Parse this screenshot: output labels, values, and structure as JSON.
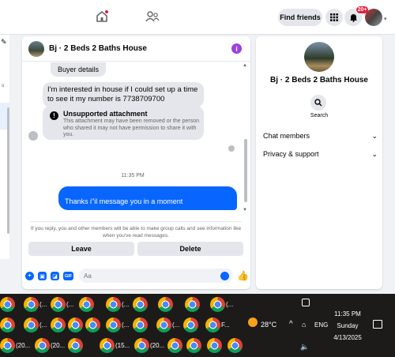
{
  "topbar": {
    "find_friends": "Find friends",
    "notification_count": "20+"
  },
  "chat": {
    "title": "Bj · 2 Beds 2 Baths House",
    "buyer_details": "Buyer details",
    "message_1": "I'm interested in house if I could set up a time to see it my number is 7738709700",
    "unsupported_title": "Unsupported attachment",
    "unsupported_text": "This attachment may have been removed or the person who shared it may not have permission to share it with you.",
    "timestamp": "11:35 PM",
    "my_message": "Thanks i\"il message you in a moment",
    "notice": "If you reply, you and other members will be able to make group calls and see information like when you've read messages.",
    "leave": "Leave",
    "delete": "Delete",
    "input_placeholder": "Aa",
    "gif_label": "GIF"
  },
  "details": {
    "group_name": "Bj · 2 Beds 2 Baths House",
    "search_label": "Search",
    "sections": [
      {
        "label": "Chat members"
      },
      {
        "label": "Privacy & support"
      }
    ]
  },
  "taskbar": {
    "row1_labels": [
      "(...",
      "(...",
      "(...",
      "(..."
    ],
    "row2_labels": [
      "(...",
      "(...",
      "(...",
      "F..."
    ],
    "row3_labels": [
      "(20...",
      "(20...",
      "(15...",
      "(20..."
    ],
    "weather": "28°C",
    "language": "ENG",
    "time": "11:35 PM",
    "day": "Sunday",
    "date": "4/13/2025"
  }
}
